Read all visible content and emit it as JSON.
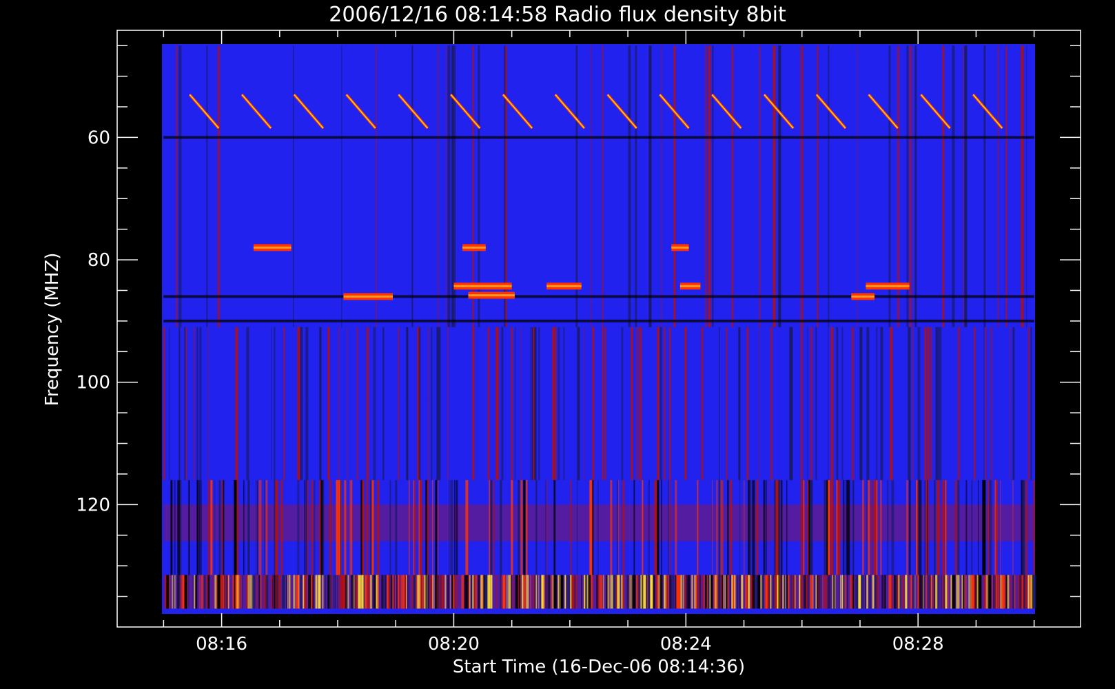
{
  "chart_data": {
    "type": "heatmap",
    "title": "2006/12/16 08:14:58 Radio flux density 8bit",
    "xlabel": "Start Time (16-Dec-06 08:14:36)",
    "ylabel": "Frequency (MHZ)",
    "x_major_ticks": [
      "08:16",
      "08:20",
      "08:24",
      "08:28"
    ],
    "x_major_values": [
      16,
      20,
      24,
      28
    ],
    "x_minor_values": [
      15,
      17,
      18,
      19,
      21,
      22,
      23,
      25,
      26,
      27,
      29,
      30
    ],
    "x_range_minutes": [
      14.2,
      30.8
    ],
    "y_major_ticks": [
      "60",
      "80",
      "100",
      "120"
    ],
    "y_major_values": [
      60,
      80,
      100,
      120
    ],
    "y_minor_values": [
      45,
      50,
      55,
      65,
      70,
      75,
      85,
      90,
      95,
      105,
      110,
      115,
      125,
      130,
      135
    ],
    "y_range_mhz": [
      42.5,
      140
    ],
    "y_inverted": true,
    "data_x_range_minutes": [
      15,
      30
    ],
    "data_y_range_mhz": [
      45,
      137
    ],
    "colormap": [
      "#000000",
      "#1a1a66",
      "#2222ee",
      "#b01010",
      "#ff3300",
      "#ffdd33"
    ],
    "background_level": 2,
    "fine_features": {
      "description_hidden": true,
      "drift_burst_start_minutes": [
        15.45,
        16.35,
        17.25,
        18.15,
        19.05,
        19.95,
        20.85,
        21.75,
        22.65,
        23.55,
        24.45,
        25.35,
        26.25,
        27.15,
        28.05,
        28.95
      ],
      "drift_burst_freq_mhz": [
        53,
        58.5
      ]
    },
    "bright_segments": [
      {
        "t0": 16.55,
        "t1": 17.2,
        "f": 78
      },
      {
        "t0": 20.15,
        "t1": 20.55,
        "f": 78
      },
      {
        "t0": 23.75,
        "t1": 24.05,
        "f": 78
      },
      {
        "t0": 20.0,
        "t1": 21.0,
        "f": 84.3
      },
      {
        "t0": 20.25,
        "t1": 21.05,
        "f": 85.8
      },
      {
        "t0": 21.6,
        "t1": 22.2,
        "f": 84.3
      },
      {
        "t0": 18.1,
        "t1": 18.95,
        "f": 86.0
      },
      {
        "t0": 23.9,
        "t1": 24.25,
        "f": 84.3
      },
      {
        "t0": 26.85,
        "t1": 27.25,
        "f": 86.0
      },
      {
        "t0": 27.1,
        "t1": 27.85,
        "f": 84.3
      }
    ],
    "dark_lines_mhz": [
      60,
      86,
      90
    ],
    "bands_mhz": [
      {
        "f0": 45,
        "f1": 60,
        "level": 2
      },
      {
        "f0": 60,
        "f1": 91,
        "level": 2
      },
      {
        "f0": 91,
        "f1": 103,
        "level": 2
      },
      {
        "f0": 103,
        "f1": 116,
        "level": 2
      },
      {
        "f0": 116,
        "f1": 120,
        "level": 2
      },
      {
        "f0": 120,
        "f1": 126,
        "level": 3
      },
      {
        "f0": 126,
        "f1": 131.5,
        "level": 2
      },
      {
        "f0": 131.5,
        "f1": 137,
        "level": 3
      }
    ]
  }
}
